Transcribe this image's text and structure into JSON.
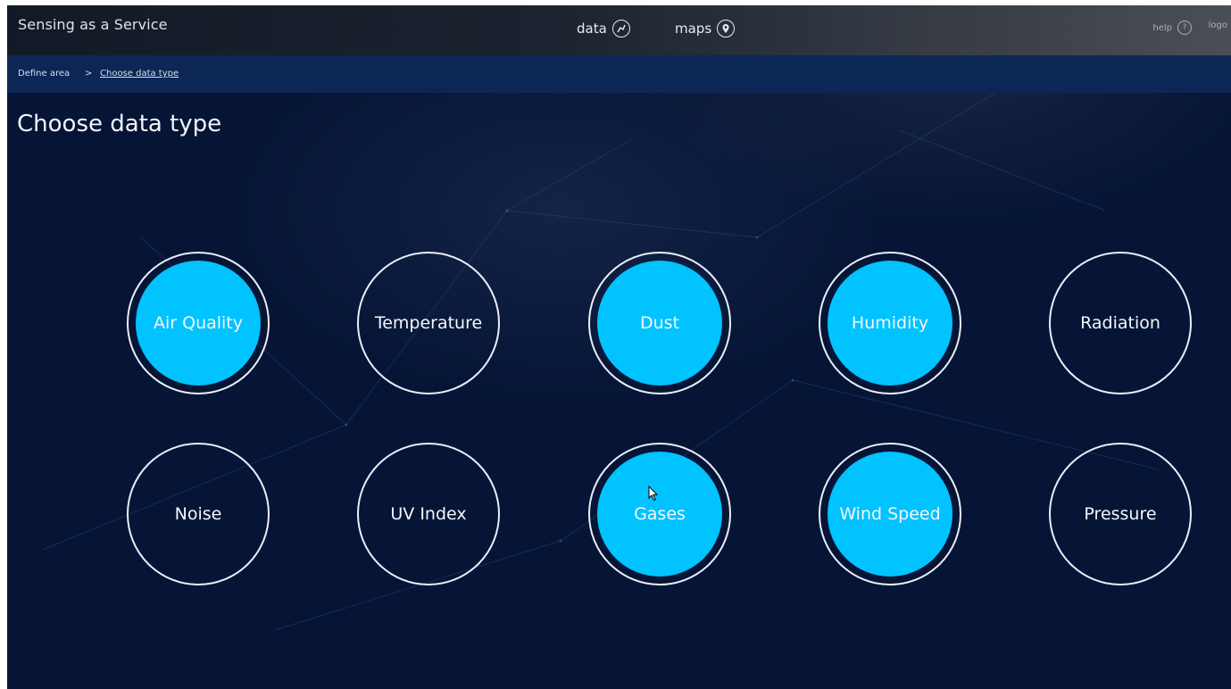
{
  "app": {
    "title": "Sensing as a Service"
  },
  "nav": {
    "items": [
      {
        "label": "data",
        "icon": "chart-icon"
      },
      {
        "label": "maps",
        "icon": "map-pin-icon"
      }
    ],
    "help_label": "help",
    "help_icon": "?",
    "logout_label": "logo"
  },
  "breadcrumb": {
    "items": [
      "Define area",
      "Choose data type"
    ],
    "separator": ">"
  },
  "page": {
    "title": "Choose data type"
  },
  "colors": {
    "background": "#061536",
    "breadcrumb_bar": "#0c2656",
    "selected_fill": "#00c3ff",
    "ring": "#e9eef6"
  },
  "data_types": [
    {
      "label": "Air Quality",
      "selected": true
    },
    {
      "label": "Temperature",
      "selected": false
    },
    {
      "label": "Dust",
      "selected": true
    },
    {
      "label": "Humidity",
      "selected": true
    },
    {
      "label": "Radiation",
      "selected": false
    },
    {
      "label": "Noise",
      "selected": false
    },
    {
      "label": "UV Index",
      "selected": false
    },
    {
      "label": "Gases",
      "selected": true
    },
    {
      "label": "Wind Speed",
      "selected": true
    },
    {
      "label": "Pressure",
      "selected": false
    }
  ]
}
